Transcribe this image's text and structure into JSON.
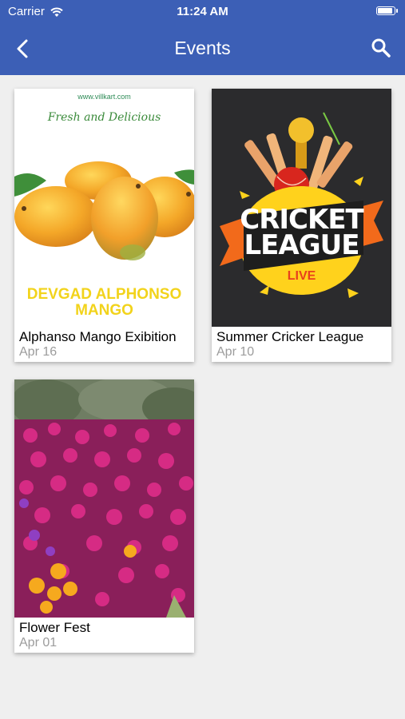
{
  "status": {
    "carrier": "Carrier",
    "time": "11:24 AM"
  },
  "nav": {
    "title": "Events"
  },
  "events": [
    {
      "title": "Alphanso Mango Exibition",
      "date": "Apr 16",
      "poster": {
        "site": "www.villkart.com",
        "tagline": "Fresh and Delicious",
        "headline_1": "DEVGAD ALPHONSO",
        "headline_2": "MANGO"
      }
    },
    {
      "title": "Summer Cricker League",
      "date": "Apr 10",
      "poster": {
        "line_1": "CRICKET",
        "line_2": "LEAGUE",
        "badge": "LIVE"
      }
    },
    {
      "title": "Flower Fest",
      "date": "Apr 01",
      "poster": {}
    }
  ]
}
